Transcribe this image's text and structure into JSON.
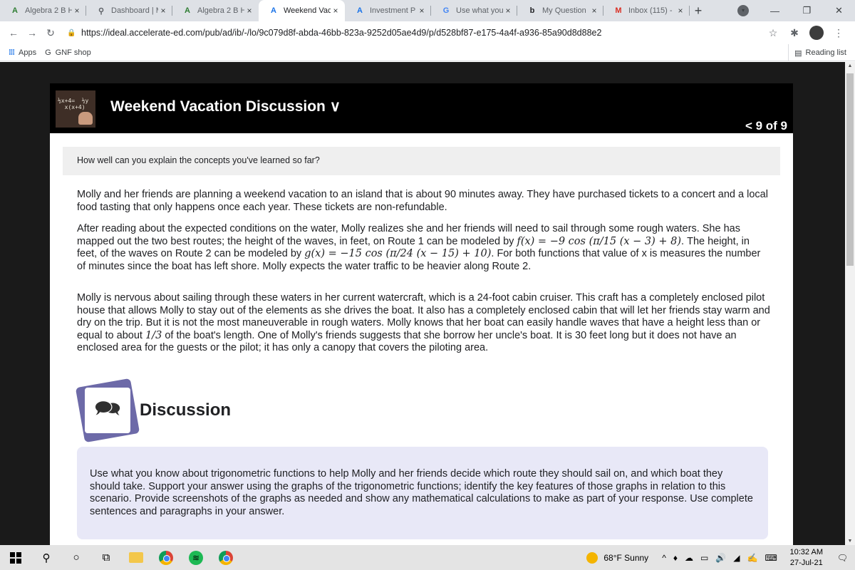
{
  "browser": {
    "tabs": [
      {
        "label": "Algebra 2 B H",
        "icon": "A",
        "icon_color": "#2e7d32",
        "active": false
      },
      {
        "label": "Dashboard | M",
        "icon": "⚲",
        "icon_color": "#5f6368",
        "active": false
      },
      {
        "label": "Algebra 2 B H",
        "icon": "A",
        "icon_color": "#2e7d32",
        "active": false
      },
      {
        "label": "Weekend Vac",
        "icon": "A",
        "icon_color": "#1a73e8",
        "active": true
      },
      {
        "label": "Investment P",
        "icon": "A",
        "icon_color": "#1a73e8",
        "active": false
      },
      {
        "label": "Use what you",
        "icon": "G",
        "icon_color": "#4285f4",
        "active": false
      },
      {
        "label": "My Question",
        "icon": "b",
        "icon_color": "#202124",
        "active": false
      },
      {
        "label": "Inbox (115) -",
        "icon": "M",
        "icon_color": "#d93025",
        "active": false
      }
    ],
    "tab_close": "×",
    "new_tab": "+",
    "window_controls": {
      "minimize": "—",
      "restore": "❐",
      "close": "✕",
      "profile_menu": "▾"
    },
    "url": "https://ideal.accelerate-ed.com/pub/ad/ib/-/lo/9c079d8f-abda-46bb-823a-9252d05ae4d9/p/d528bf87-e175-4a4f-a936-85a90d8d88e2",
    "nav": {
      "back": "←",
      "forward": "→",
      "reload": "↻",
      "lock": "🔒"
    },
    "toolbar_icons": {
      "star": "☆",
      "extensions": "✱",
      "menu": "⋮"
    },
    "bookmarks": [
      {
        "label": "Apps",
        "icon": "⁞⁞⁞"
      },
      {
        "label": "GNF shop",
        "icon": "G"
      }
    ],
    "reading_list": {
      "label": "Reading list",
      "icon": "▤"
    }
  },
  "lesson": {
    "title": "Weekend Vacation Discussion ∨",
    "pager": "< 9 of 9",
    "logo_chalk": "½x+4=  ½y\n  x(x+4)",
    "prompt": "How well can you explain the concepts you've learned so far?",
    "paragraph1": "Molly and her friends are planning a weekend vacation to an island that is about 90 minutes away. They have purchased tickets to a concert and a local food tasting that only happens once each year. These tickets are non-refundable.",
    "paragraph2_a": "After reading about the expected conditions on the water, Molly realizes she and her friends will need to sail through some rough waters. She has mapped out the two best routes; the height of the waves, in feet, on Route 1 can be modeled by ",
    "f_formula": "f(x) = −9 cos (π/15 (x − 3) + 8)",
    "paragraph2_b": ". The height, in feet, of the waves on Route 2 can be modeled by ",
    "g_formula": "g(x) = −15 cos (π/24 (x − 15) + 10)",
    "paragraph2_c": ". For both functions that value of x is measures the number of minutes since the boat has left shore. Molly expects the water traffic to be heavier along Route 2.",
    "paragraph3_a": "Molly is nervous about sailing through these waters in her current watercraft, which is a 24-foot cabin cruiser. This craft has a completely enclosed pilot house that allows Molly to stay out of the elements as she drives the boat. It also has a completely enclosed cabin that will let her friends stay warm and dry on the trip. But it is not the most maneuverable in rough waters. Molly knows that her boat can easily handle waves that have a height less than or equal to about ",
    "fraction": "1/3",
    "paragraph3_b": " of the boat's length. One of Molly's friends suggests that she borrow her uncle's boat. It is 30 feet long but it does not have an enclosed area for the guests or the pilot; it has only a canopy that covers the piloting area.",
    "discussion_heading": "Discussion",
    "discussion_icon": "🗪",
    "discussion_text": "Use what you know about trigonometric functions to help Molly and her friends decide which route they should sail on, and which boat they should take. Support your answer using the graphs of the trigonometric functions; identify the key features of those graphs in relation to this scenario. Provide screenshots of the graphs as needed and show any mathematical calculations to make as part of your response. Use complete sentences and paragraphs in your answer."
  },
  "taskbar": {
    "search_icon": "⚲",
    "cortana_icon": "○",
    "taskview_icon": "⧉",
    "weather": "68°F  Sunny",
    "tray_icons": [
      "^",
      "♦",
      "☁",
      "▭",
      "🔊",
      "◢",
      "✍",
      "⌨"
    ],
    "time": "10:32 AM",
    "date": "27-Jul-21",
    "notification_icon": "🗨"
  },
  "colors": {
    "page_background": "#1a1a1a",
    "header_background": "#000000",
    "discussion_box": "#e8e8f7",
    "discussion_icon": "#6d6aa8"
  }
}
